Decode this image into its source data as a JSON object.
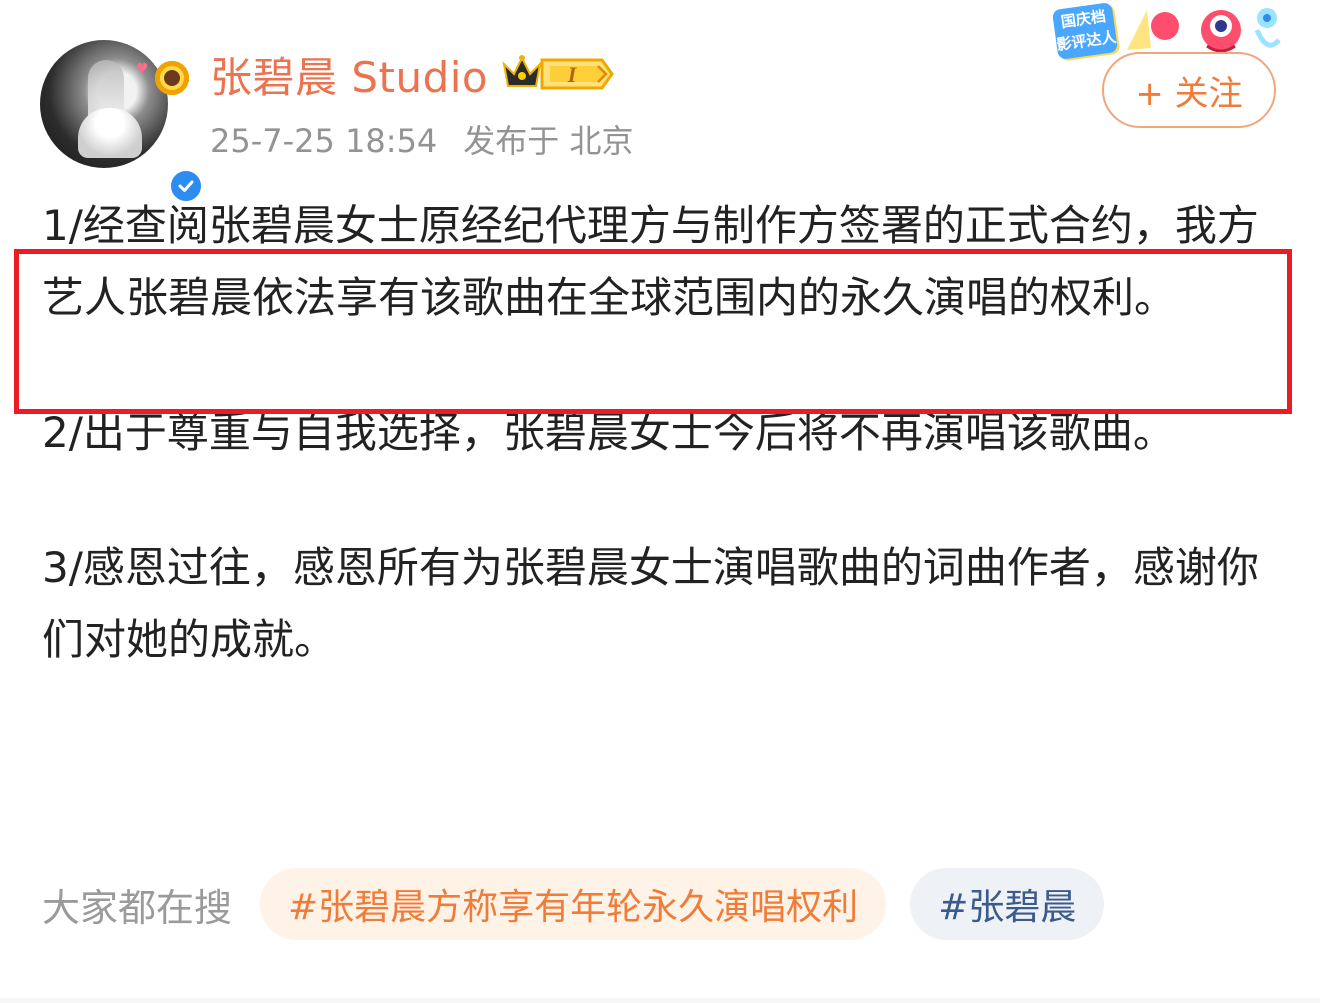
{
  "post": {
    "author": {
      "name": "张碧晨 Studio",
      "timestamp": "25-7-25 18:54",
      "location": "发布于 北京",
      "vip_level": "I"
    },
    "follow_label": "+ 关注",
    "event_badge": "国庆档 影评达人",
    "paragraphs": [
      "1/经查阅张碧晨女士原经纪代理方与制作方签署的正式合约，我方艺人张碧晨依法享有该歌曲在全球范围内的永久演唱的权利。",
      "2/出于尊重与自我选择，张碧晨女士今后将不再演唱该歌曲。",
      "3/感恩过往，感恩所有为张碧晨女士演唱歌曲的词曲作者，感谢你们对她的成就。"
    ]
  },
  "search": {
    "label": "大家都在搜",
    "tags": [
      "#张碧晨方称享有年轮永久演唱权利",
      "#张碧晨"
    ]
  },
  "colors": {
    "name": "#eb7350",
    "follow": "#f07c3a",
    "highlight_box": "#ec1c24",
    "verified": "#2d8cf0"
  }
}
